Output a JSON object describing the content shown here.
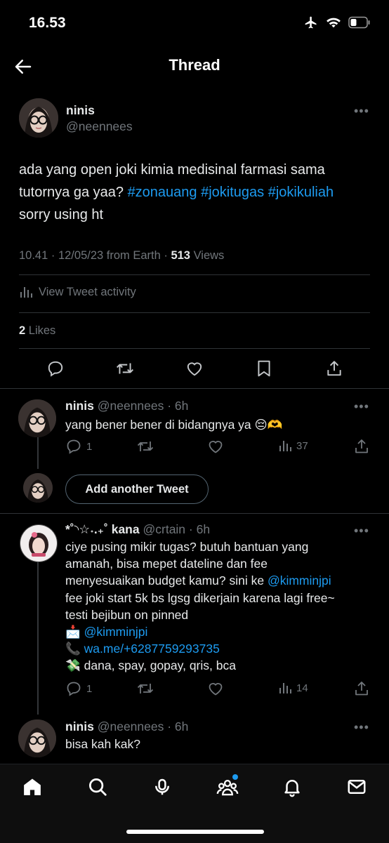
{
  "status": {
    "time": "16.53"
  },
  "header": {
    "title": "Thread"
  },
  "main_tweet": {
    "name": "ninis",
    "handle": "@neennees",
    "text_plain": "ada yang open joki kimia medisinal farmasi sama tutornya ga yaa?",
    "hashtags": [
      "#zonauang",
      "#jokitugas",
      "#jokikuliah"
    ],
    "text_tail": "sorry using ht",
    "timestamp": "10.41 · 12/05/23 from Earth · ",
    "views_count": "513",
    "views_label": "Views",
    "activity_label": "View Tweet activity",
    "likes_count": "2",
    "likes_label": "Likes"
  },
  "reply1": {
    "name": "ninis",
    "handle": "@neennees · 6h",
    "text": "yang bener bener di bidangnya ya 😔🫶",
    "replies": "1",
    "views": "37"
  },
  "add_tweet": {
    "label": "Add another Tweet"
  },
  "reply2": {
    "name": "*˚◝☆˖.₊˚ kana",
    "handle": "@crtain · 6h",
    "line1": "ciye pusing mikir tugas? butuh bantuan yang",
    "line2": "amanah, bisa mepet dateline dan fee",
    "line3_prefix": "menyesuaikan budget kamu? sini ke ",
    "mention": "@kimminjpi",
    "line4": "fee joki start 5k bs lgsg dikerjain karena lagi free~",
    "line5": "testi bejibun on pinned",
    "emoji_mail": "📩",
    "contact_mention": "@kimminjpi",
    "emoji_phone": "📞",
    "contact_wa": "wa.me/+6287759293735",
    "emoji_money": "💸",
    "payments": "dana, spay, gopay, qris, bca",
    "replies": "1",
    "views": "14"
  },
  "reply3": {
    "name": "ninis",
    "handle": "@neennees · 6h",
    "text": "bisa kah kak?"
  },
  "colors": {
    "accent": "#1d9bf0",
    "muted": "#71767b",
    "background": "#000000"
  }
}
